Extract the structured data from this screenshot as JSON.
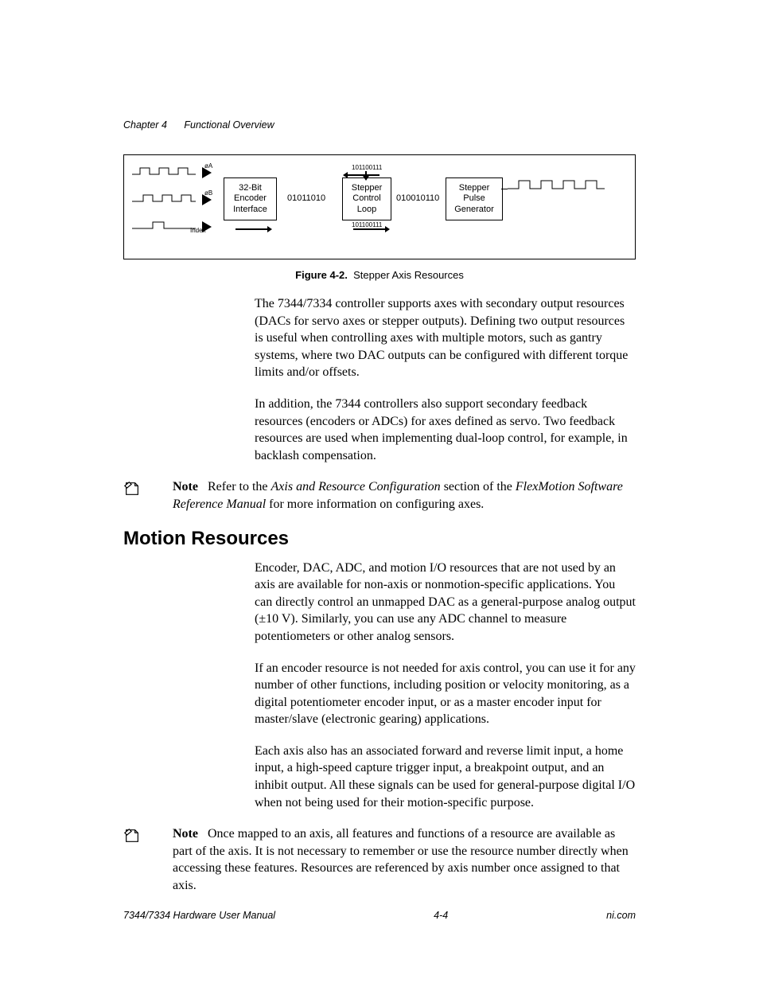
{
  "header": {
    "chapter_num": "Chapter 4",
    "chapter_title": "Functional Overview"
  },
  "figure": {
    "caption_label": "Figure 4-2.",
    "caption_text": "Stepper Axis Resources",
    "encoder_box": "32-Bit\nEncoder\nInterface",
    "control_box": "Stepper\nControl\nLoop",
    "pulse_box": "Stepper\nPulse\nGenerator",
    "sig_a": "øA",
    "sig_b": "øB",
    "sig_idx": "Index",
    "bits_left": "01011010",
    "bits_mid": "010010110",
    "bits_top": "101100111",
    "bits_bot": "101100111"
  },
  "para1": "The 7344/7334 controller supports axes with secondary output resources (DACs for servo axes or stepper outputs). Defining two output resources is useful when controlling axes with multiple motors, such as gantry systems, where two DAC outputs can be configured with different torque limits and/or offsets.",
  "para2": "In addition, the 7344 controllers also support secondary feedback resources (encoders or ADCs) for axes defined as servo. Two feedback resources are used when implementing dual-loop control, for example, in backlash compensation.",
  "note1": {
    "label": "Note",
    "pre": "Refer to the ",
    "ital1": "Axis and Resource Configuration",
    "mid": " section of the ",
    "ital2": "FlexMotion Software Reference Manual",
    "post": " for more information on configuring axes."
  },
  "section_heading": "Motion Resources",
  "para3": "Encoder, DAC, ADC, and motion I/O resources that are not used by an axis are available for non-axis or nonmotion-specific applications. You can directly control an unmapped DAC as a general-purpose analog output (±10 V). Similarly, you can use any ADC channel to measure potentiometers or other analog sensors.",
  "para4": "If an encoder resource is not needed for axis control, you can use it for any number of other functions, including position or velocity monitoring, as a digital potentiometer encoder input, or as a master encoder input for master/slave (electronic gearing) applications.",
  "para5": "Each axis also has an associated forward and reverse limit input, a home input, a high-speed capture trigger input, a breakpoint output, and an inhibit output. All these signals can be used for general-purpose digital I/O when not being used for their motion-specific purpose.",
  "note2": {
    "label": "Note",
    "text": "Once mapped to an axis, all features and functions of a resource are available as part of the axis. It is not necessary to remember or use the resource number directly when accessing these features. Resources are referenced by axis number once assigned to that axis."
  },
  "footer": {
    "left": "7344/7334 Hardware User Manual",
    "center": "4-4",
    "right": "ni.com"
  }
}
